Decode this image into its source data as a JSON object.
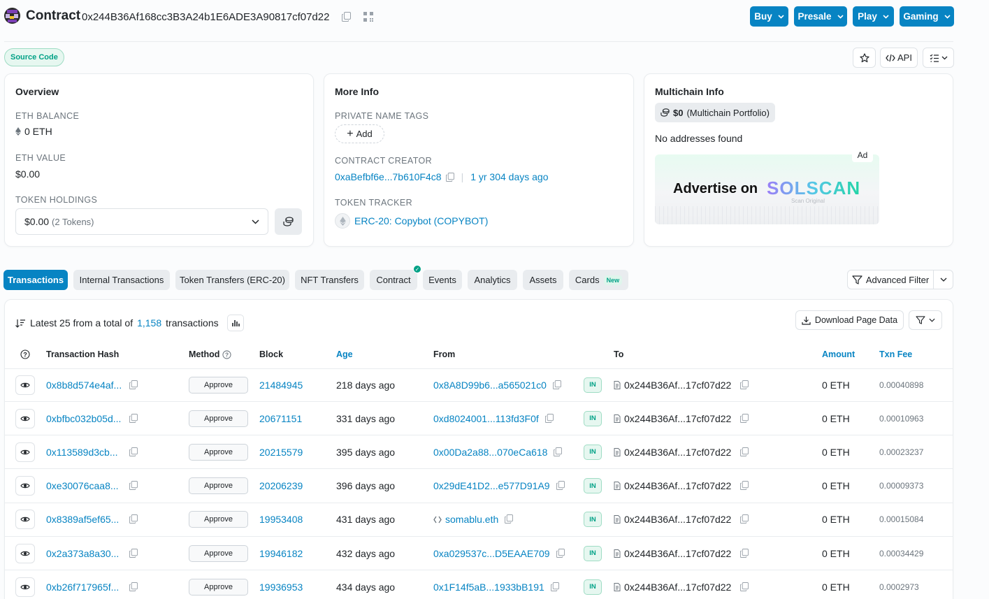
{
  "header": {
    "title": "Contract",
    "address": "0x244B36Af168cc3B3A24b1E6ADE3A90817cf07d22",
    "menu": [
      "Buy",
      "Presale",
      "Play",
      "Gaming"
    ]
  },
  "subheader": {
    "source_code_badge": "Source Code",
    "api_label": "API"
  },
  "overview": {
    "title": "Overview",
    "eth_balance_label": "ETH BALANCE",
    "eth_balance": "0 ETH",
    "eth_value_label": "ETH VALUE",
    "eth_value": "$0.00",
    "token_holdings_label": "TOKEN HOLDINGS",
    "token_holdings_value": "$0.00",
    "token_holdings_count": "(2 Tokens)"
  },
  "more_info": {
    "title": "More Info",
    "private_tags_label": "PRIVATE NAME TAGS",
    "add_label": "Add",
    "contract_creator_label": "CONTRACT CREATOR",
    "creator_address": "0xaBefbf6e...7b610F4c8",
    "creator_age": "1 yr 304 days ago",
    "token_tracker_label": "TOKEN TRACKER",
    "token_tracker": "ERC-20: Copybot (COPYBOT)"
  },
  "multichain": {
    "title": "Multichain Info",
    "portfolio_value": "$0",
    "portfolio_label": "(Multichain Portfolio)",
    "no_addresses": "No addresses found",
    "ad_tag": "Ad",
    "ad_text": "Advertise on",
    "ad_brand": "SOLSCAN",
    "ad_sub": "Scan Original"
  },
  "tabs": [
    {
      "label": "Transactions"
    },
    {
      "label": "Internal Transactions"
    },
    {
      "label": "Token Transfers (ERC-20)"
    },
    {
      "label": "NFT Transfers"
    },
    {
      "label": "Contract"
    },
    {
      "label": "Events"
    },
    {
      "label": "Analytics"
    },
    {
      "label": "Assets"
    },
    {
      "label": "Cards",
      "badge": "New"
    }
  ],
  "advanced_filter_label": "Advanced Filter",
  "summary": {
    "prefix": "Latest 25 from a total of",
    "total": "1,158",
    "suffix": "transactions"
  },
  "download_label": "Download Page Data",
  "columns": {
    "hash": "Transaction Hash",
    "method": "Method",
    "block": "Block",
    "age": "Age",
    "from": "From",
    "to": "To",
    "amount": "Amount",
    "fee": "Txn Fee"
  },
  "rows": [
    {
      "hash": "0x8b8d574e4af...",
      "method": "Approve",
      "block": "21484945",
      "age": "218 days ago",
      "from": "0x8A8D99b6...a565021c0",
      "from_ens": false,
      "direction": "IN",
      "to": "0x244B36Af...17cf07d22",
      "amount": "0 ETH",
      "fee": "0.00040898"
    },
    {
      "hash": "0xbfbc032b05d...",
      "method": "Approve",
      "block": "20671151",
      "age": "331 days ago",
      "from": "0xd8024001...113fd3F0f",
      "from_ens": false,
      "direction": "IN",
      "to": "0x244B36Af...17cf07d22",
      "amount": "0 ETH",
      "fee": "0.00010963"
    },
    {
      "hash": "0x113589d3cb...",
      "method": "Approve",
      "block": "20215579",
      "age": "395 days ago",
      "from": "0x00Da2a88...070eCa618",
      "from_ens": false,
      "direction": "IN",
      "to": "0x244B36Af...17cf07d22",
      "amount": "0 ETH",
      "fee": "0.00023237"
    },
    {
      "hash": "0xe30076caa8...",
      "method": "Approve",
      "block": "20206239",
      "age": "396 days ago",
      "from": "0x29dE41D2...e577D91A9",
      "from_ens": false,
      "direction": "IN",
      "to": "0x244B36Af...17cf07d22",
      "amount": "0 ETH",
      "fee": "0.00009373"
    },
    {
      "hash": "0x8389af5ef65...",
      "method": "Approve",
      "block": "19953408",
      "age": "431 days ago",
      "from": "somablu.eth",
      "from_ens": true,
      "direction": "IN",
      "to": "0x244B36Af...17cf07d22",
      "amount": "0 ETH",
      "fee": "0.00015084"
    },
    {
      "hash": "0x2a373a8a30...",
      "method": "Approve",
      "block": "19946182",
      "age": "432 days ago",
      "from": "0xa029537c...D5EAAE709",
      "from_ens": false,
      "direction": "IN",
      "to": "0x244B36Af...17cf07d22",
      "amount": "0 ETH",
      "fee": "0.00034429"
    },
    {
      "hash": "0xb26f717965f...",
      "method": "Approve",
      "block": "19936953",
      "age": "434 days ago",
      "from": "0x1F14f5aB...1933bB191",
      "from_ens": false,
      "direction": "IN",
      "to": "0x244B36Af...17cf07d22",
      "amount": "0 ETH",
      "fee": "0.0002973"
    }
  ],
  "colors": {
    "primary": "#0784c3",
    "success": "#00a186"
  }
}
